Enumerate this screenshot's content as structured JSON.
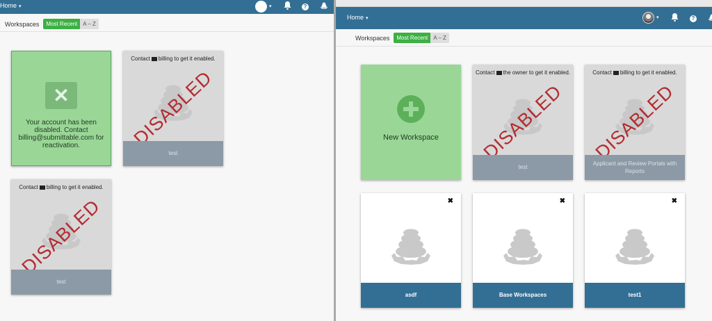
{
  "left": {
    "nav": {
      "home_label": "Home",
      "caret": "▾"
    },
    "filter": {
      "label": "Workspaces",
      "most_recent": "Most Recent",
      "az": "A – Z"
    },
    "account_card": {
      "icon": "close-icon",
      "message": "Your account has been disabled. Contact billing@submittable.com for reactivation."
    },
    "cards": [
      {
        "contact_prefix": "Contact",
        "contact_suffix": "billing to get it enabled.",
        "stamp": "DISABLED",
        "footer": "test"
      },
      {
        "contact_prefix": "Contact",
        "contact_suffix": "billing to get it enabled.",
        "stamp": "DISABLED",
        "footer": "test"
      }
    ]
  },
  "right": {
    "nav": {
      "home_label": "Home",
      "caret": "▾"
    },
    "filter": {
      "label": "Workspaces",
      "most_recent": "Most Recent",
      "az": "A – Z"
    },
    "new_workspace": {
      "label": "New Workspace",
      "icon": "plus-circle-icon"
    },
    "disabled_cards": [
      {
        "contact_prefix": "Contact",
        "contact_suffix": "the owner to get it enabled.",
        "stamp": "DISABLED",
        "footer": "test"
      },
      {
        "contact_prefix": "Contact",
        "contact_suffix": "billing to get it enabled.",
        "stamp": "DISABLED",
        "footer": "Applicant and Review Portals with Reports"
      }
    ],
    "workspaces": [
      {
        "name": "asdf",
        "close": "✖"
      },
      {
        "name": "Base Workspaces",
        "close": "✖"
      },
      {
        "name": "test1",
        "close": "✖"
      }
    ]
  },
  "colors": {
    "navbar": "#336f94",
    "green_card": "#9ad797",
    "active_pill": "#3cb042",
    "stamp": "#b11e24",
    "disabled_footer": "#8b9aa6"
  }
}
